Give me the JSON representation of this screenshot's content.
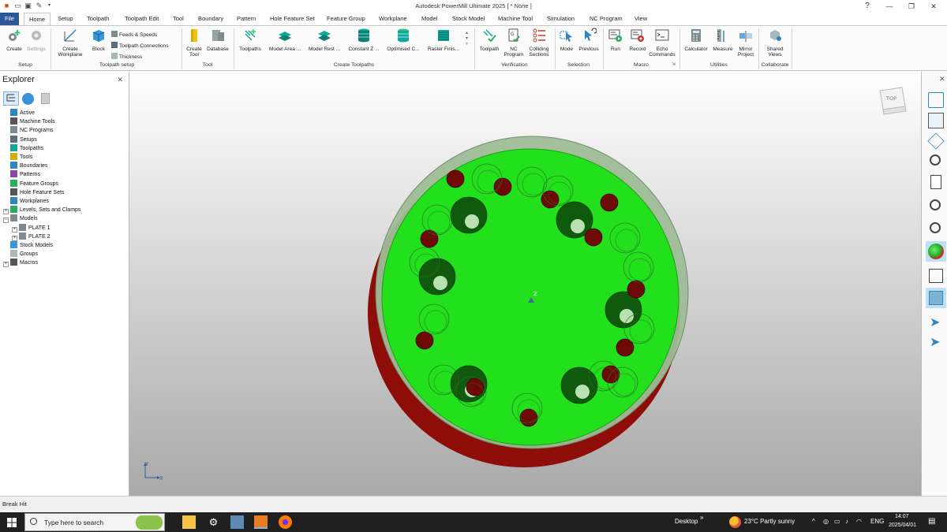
{
  "window": {
    "title": "Autodesk PowerMill Ultimate 2025   [ * None ]",
    "help_icon": "help-icon",
    "min": "—",
    "max": "❐",
    "close": "✕"
  },
  "tabs": [
    "File",
    "Home",
    "Setup",
    "Toolpath",
    "Toolpath Edit",
    "Tool",
    "Boundary",
    "Pattern",
    "Hole Feature Set",
    "Feature Group",
    "Workplane",
    "Model",
    "Stock Model",
    "Machine Tool",
    "Simulation",
    "NC Program",
    "View"
  ],
  "active_tab": "Home",
  "ribbon": {
    "setup": {
      "label": "Setup",
      "create": "Create",
      "settings": "Settings"
    },
    "toolpath_setup": {
      "label": "Toolpath setup",
      "create_workplane": "Create",
      "create_workplane_2": "Workplane",
      "block": "Block",
      "feeds": "Feeds & Speeds",
      "connections": "Toolpath Connections",
      "thickness": "Thickness"
    },
    "tool": {
      "label": "Tool",
      "create_tool": "Create",
      "create_tool_2": "Tool",
      "database": "Database"
    },
    "create_toolpaths": {
      "label": "Create Toolpaths",
      "toolpaths": "Toolpaths",
      "model_area": "Model Area ...",
      "model_rest": "Model Rest ...",
      "constant_z": "Constant Z ...",
      "optimised": "Optimised C...",
      "raster": "Raster Finis..."
    },
    "verification": {
      "label": "Verification",
      "toolpath": "Toolpath",
      "nc_program": "NC",
      "nc_program_2": "Program",
      "colliding": "Colliding",
      "colliding_2": "Sections"
    },
    "selection": {
      "label": "Selection",
      "mode": "Mode",
      "previous": "Previous"
    },
    "macro": {
      "label": "Macro",
      "run": "Run",
      "record": "Record",
      "echo": "Echo",
      "echo_2": "Commands"
    },
    "utilities": {
      "label": "Utilities",
      "calculator": "Calculator",
      "measure": "Measure",
      "mirror": "Mirror",
      "mirror_2": "Project"
    },
    "collaborate": {
      "label": "Collaborate",
      "shared": "Shared",
      "shared_2": "Views"
    }
  },
  "explorer": {
    "title": "Explorer",
    "items": [
      {
        "label": "Active",
        "indent": 1,
        "expander": ""
      },
      {
        "label": "Machine Tools",
        "indent": 1,
        "expander": ""
      },
      {
        "label": "NC Programs",
        "indent": 1,
        "expander": ""
      },
      {
        "label": "Setups",
        "indent": 1,
        "expander": ""
      },
      {
        "label": "Toolpaths",
        "indent": 1,
        "expander": ""
      },
      {
        "label": "Tools",
        "indent": 1,
        "expander": ""
      },
      {
        "label": "Boundaries",
        "indent": 1,
        "expander": ""
      },
      {
        "label": "Patterns",
        "indent": 1,
        "expander": ""
      },
      {
        "label": "Feature Groups",
        "indent": 1,
        "expander": ""
      },
      {
        "label": "Hole Feature Sets",
        "indent": 1,
        "expander": ""
      },
      {
        "label": "Workplanes",
        "indent": 1,
        "expander": ""
      },
      {
        "label": "Levels, Sets and Clamps",
        "indent": 0,
        "expander": "+"
      },
      {
        "label": "Models",
        "indent": 0,
        "expander": "−"
      },
      {
        "label": "PLATE 1",
        "indent": 2,
        "expander": "+"
      },
      {
        "label": "PLATE 2",
        "indent": 2,
        "expander": "+"
      },
      {
        "label": "Stock Models",
        "indent": 1,
        "expander": ""
      },
      {
        "label": "Groups",
        "indent": 1,
        "expander": ""
      },
      {
        "label": "Macros",
        "indent": 0,
        "expander": "+"
      }
    ]
  },
  "viewport": {
    "viewcube_face": "TOP",
    "z_label": "Z",
    "axis_y": "Y",
    "axis_x": "X"
  },
  "status": {
    "text": "Break Hit"
  },
  "taskbar": {
    "search_placeholder": "Type here to search",
    "desktop": "Desktop",
    "weather": "23°C  Partly sunny",
    "lang": "ENG",
    "time": "14:07",
    "date": "2025/04/01",
    "chevrons": "»",
    "tray_up": "^"
  },
  "colors": {
    "accent": "#2b579a",
    "part_green": "#22e11c",
    "part_red": "#8f0d08",
    "teal": "#12a89c"
  }
}
